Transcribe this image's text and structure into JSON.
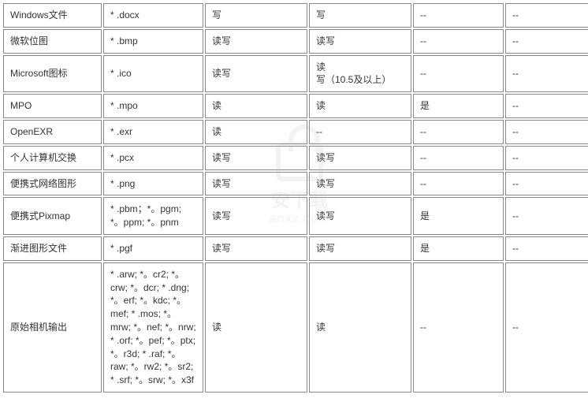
{
  "watermark": {
    "text": "安下载",
    "url": "anxz.com"
  },
  "table": {
    "rows": [
      {
        "c0": "Windows文件",
        "c1": "* .docx",
        "c2": "写",
        "c3": "写",
        "c4": "--",
        "c5": "--"
      },
      {
        "c0": "微软位图",
        "c1": "* .bmp",
        "c2": "读写",
        "c3": "读写",
        "c4": "--",
        "c5": "--"
      },
      {
        "c0": "Microsoft图标",
        "c1": "* .ico",
        "c2": "读写",
        "c3": "读\n写（10.5及以上）",
        "c4": "--",
        "c5": "--"
      },
      {
        "c0": "MPO",
        "c1": "* .mpo",
        "c2": "读",
        "c3": "读",
        "c4": "是",
        "c5": "--"
      },
      {
        "c0": "OpenEXR",
        "c1": "* .exr",
        "c2": "读",
        "c3": "--",
        "c4": "--",
        "c5": "--"
      },
      {
        "c0": "个人计算机交换",
        "c1": "* .pcx",
        "c2": "读写",
        "c3": "读写",
        "c4": "--",
        "c5": "--"
      },
      {
        "c0": "便携式网络图形",
        "c1": "* .png",
        "c2": "读写",
        "c3": "读写",
        "c4": "--",
        "c5": "--"
      },
      {
        "c0": "便携式Pixmap",
        "c1": "* .pbm；*。pgm; *。ppm; *。pnm",
        "c2": "读写",
        "c3": "读写",
        "c4": "是",
        "c5": "--"
      },
      {
        "c0": "渐进图形文件",
        "c1": "* .pgf",
        "c2": "读写",
        "c3": "读写",
        "c4": "是",
        "c5": "--"
      },
      {
        "c0": "原始相机输出",
        "c1": "* .arw; *。cr2; *。crw; *。dcr; * .dng; *。erf; *。kdc; *。mef; * .mos; *。mrw; *。nef; *。nrw; * .orf; *。pef; *。ptx; *。r3d; * .raf; *。raw; *。rw2; *。sr2; * .srf; *。srw; *。x3f",
        "c2": "读",
        "c3": "读",
        "c4": "--",
        "c5": "--"
      }
    ]
  }
}
